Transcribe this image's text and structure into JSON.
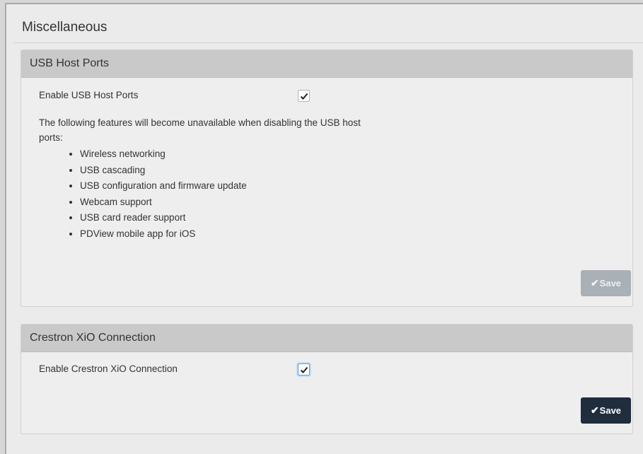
{
  "page": {
    "title": "Miscellaneous"
  },
  "usb_panel": {
    "header": "USB Host Ports",
    "enable_label": "Enable USB Host Ports",
    "enable_checked": true,
    "description": "The following features will become unavailable when disabling the USB host ports:",
    "features": [
      "Wireless networking",
      "USB cascading",
      "USB configuration and firmware update",
      "Webcam support",
      "USB card reader support",
      "PDView mobile app for iOS"
    ],
    "save_label": "Save",
    "save_enabled": false
  },
  "crestron_panel": {
    "header": "Crestron XiO Connection",
    "enable_label": "Enable Crestron XiO Connection",
    "enable_checked": true,
    "save_label": "Save",
    "save_enabled": true
  },
  "icons": {
    "check": "check-icon"
  },
  "colors": {
    "save_enabled": "#1f2d3d",
    "save_disabled": "#a9b0b6",
    "header_bg": "#c9c9c9"
  }
}
